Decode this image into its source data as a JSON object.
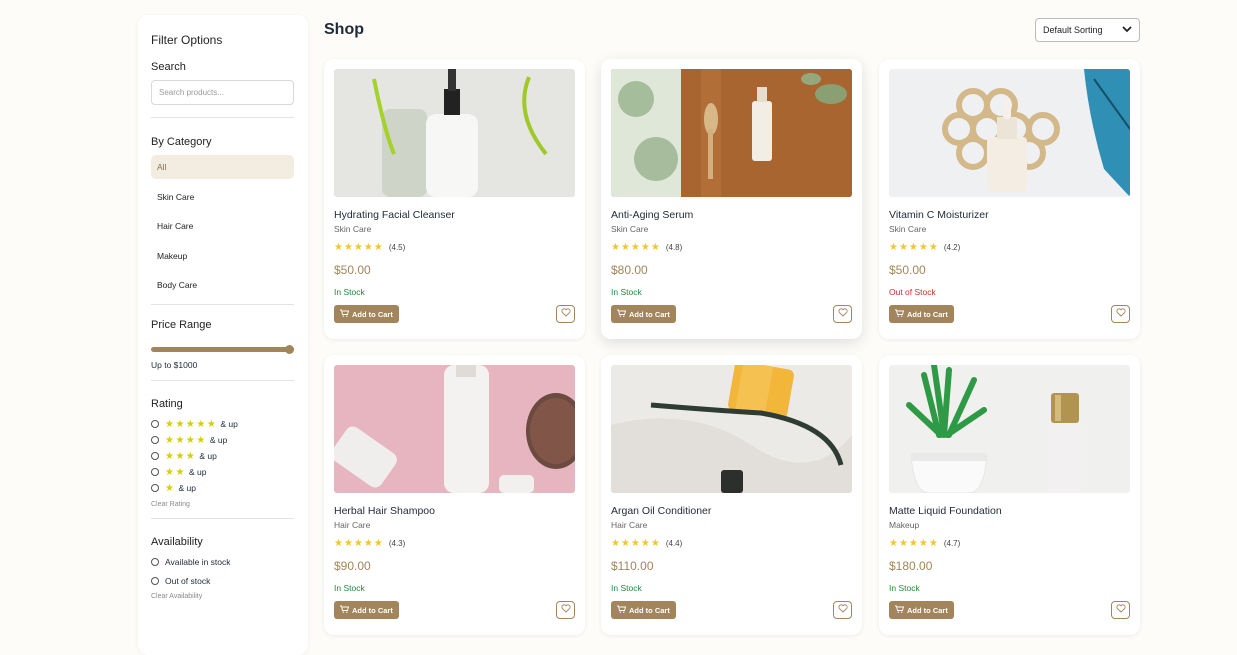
{
  "sidebar": {
    "title": "Filter Options",
    "search": {
      "label": "Search",
      "placeholder": "Search products..."
    },
    "category": {
      "label": "By Category",
      "items": [
        "All",
        "Skin Care",
        "Hair Care",
        "Makeup",
        "Body Care"
      ],
      "selected": "All"
    },
    "price": {
      "label": "Price Range",
      "value_label": "Up to $1000",
      "value": 1000
    },
    "rating": {
      "label": "Rating",
      "options": [
        {
          "stars": "★★★★★",
          "suffix": "& up"
        },
        {
          "stars": "★★★★",
          "suffix": "& up"
        },
        {
          "stars": "★★★",
          "suffix": "& up"
        },
        {
          "stars": "★★",
          "suffix": "& up"
        },
        {
          "stars": "★",
          "suffix": "& up"
        }
      ],
      "clear": "Clear Rating"
    },
    "availability": {
      "label": "Availability",
      "options": [
        "Available in stock",
        "Out of stock"
      ],
      "clear": "Clear Availability"
    }
  },
  "main": {
    "title": "Shop",
    "sort": {
      "selected": "Default Sorting"
    },
    "add_to_cart": "Add to Cart",
    "products": [
      {
        "name": "Hydrating Facial Cleanser",
        "category": "Skin Care",
        "stars": "★★★★★",
        "rating": "(4.5)",
        "price": "$50.00",
        "stock": "In Stock",
        "in_stock": true
      },
      {
        "name": "Anti-Aging Serum",
        "category": "Skin Care",
        "stars": "★★★★★",
        "rating": "(4.8)",
        "price": "$80.00",
        "stock": "In Stock",
        "in_stock": true
      },
      {
        "name": "Vitamin C Moisturizer",
        "category": "Skin Care",
        "stars": "★★★★★",
        "rating": "(4.2)",
        "price": "$50.00",
        "stock": "Out of Stock",
        "in_stock": false
      },
      {
        "name": "Herbal Hair Shampoo",
        "category": "Hair Care",
        "stars": "★★★★★",
        "rating": "(4.3)",
        "price": "$90.00",
        "stock": "In Stock",
        "in_stock": true
      },
      {
        "name": "Argan Oil Conditioner",
        "category": "Hair Care",
        "stars": "★★★★★",
        "rating": "(4.4)",
        "price": "$110.00",
        "stock": "In Stock",
        "in_stock": true
      },
      {
        "name": "Matte Liquid Foundation",
        "category": "Makeup",
        "stars": "★★★★★",
        "rating": "(4.7)",
        "price": "$180.00",
        "stock": "In Stock",
        "in_stock": true
      }
    ]
  },
  "colors": {
    "accent": "#a2855b",
    "in_stock": "#1e8a3a",
    "out_of_stock": "#d02b2b",
    "star": "#f2c531"
  }
}
